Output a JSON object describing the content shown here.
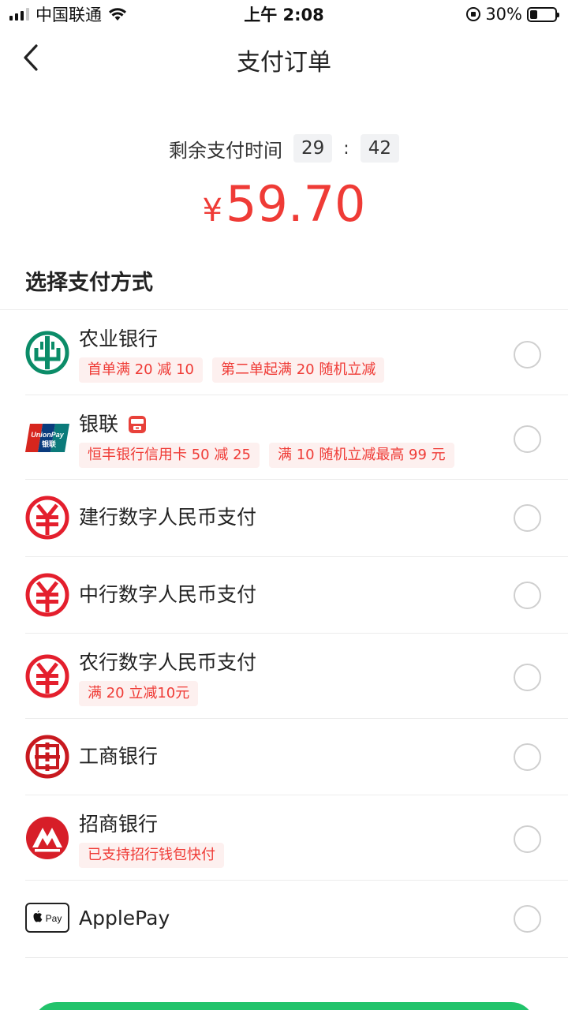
{
  "status_bar": {
    "carrier": "中国联通",
    "time": "上午 2:08",
    "battery": "30%",
    "battery_level": 0.3
  },
  "nav": {
    "title": "支付订单",
    "back_icon": "chevron-left-icon"
  },
  "countdown": {
    "label": "剩余支付时间",
    "minutes": "29",
    "separator": ":",
    "seconds": "42"
  },
  "amount": {
    "currency": "¥",
    "value": "59.70"
  },
  "section": {
    "title": "选择支付方式"
  },
  "methods": [
    {
      "name": "农业银行",
      "icon": "abc-bank-icon",
      "tags": [
        "首单满 20 减 10",
        "第二单起满 20 随机立减"
      ]
    },
    {
      "name": "银联",
      "icon": "unionpay-icon",
      "badge_icon": "yunshanfu-icon",
      "tags": [
        "恒丰银行信用卡 50 减 25",
        "满 10 随机立减最高 99 元"
      ]
    },
    {
      "name": "建行数字人民币支付",
      "icon": "digital-rmb-icon",
      "tags": []
    },
    {
      "name": "中行数字人民币支付",
      "icon": "digital-rmb-icon",
      "tags": []
    },
    {
      "name": "农行数字人民币支付",
      "icon": "digital-rmb-icon",
      "tags": [
        "满 20 立减10元"
      ]
    },
    {
      "name": "工商银行",
      "icon": "icbc-icon",
      "tags": []
    },
    {
      "name": "招商银行",
      "icon": "cmb-icon",
      "tags": [
        "已支持招行钱包快付"
      ]
    },
    {
      "name": "ApplePay",
      "icon": "apple-pay-icon",
      "tags": []
    }
  ],
  "colors": {
    "accent_red": "#ef3b36",
    "tag_bg": "#fdf0ef",
    "pay_green": "#22c36b"
  }
}
